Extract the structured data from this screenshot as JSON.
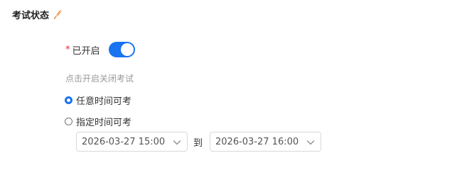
{
  "section": {
    "title": "考试状态",
    "title_icon": "feather-pen-icon"
  },
  "status": {
    "required_mark": "*",
    "label": "已开启",
    "toggle_on": true,
    "toggle_color": "#1a73f0",
    "hint": "点击开启关闭考试"
  },
  "time_mode": {
    "options": [
      {
        "label": "任意时间可考",
        "checked": true
      },
      {
        "label": "指定时间可考",
        "checked": false
      }
    ]
  },
  "time_range": {
    "start": "2026-03-27 15:00",
    "separator": "到",
    "end": "2026-03-27 16:00"
  }
}
